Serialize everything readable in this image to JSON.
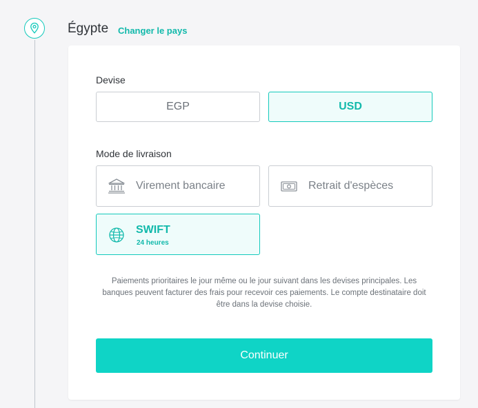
{
  "country": {
    "name": "Égypte",
    "change_link": "Changer le pays",
    "icon": "location-pin-icon"
  },
  "currency": {
    "label": "Devise",
    "options": [
      {
        "label": "EGP",
        "selected": false
      },
      {
        "label": "USD",
        "selected": true
      }
    ]
  },
  "delivery": {
    "label": "Mode de livraison",
    "options": [
      {
        "label": "Virement bancaire",
        "icon": "bank-icon",
        "selected": false
      },
      {
        "label": "Retrait d'espèces",
        "icon": "cash-icon",
        "selected": false
      },
      {
        "label": "SWIFT",
        "sublabel": "24 heures",
        "icon": "globe-icon",
        "selected": true
      }
    ]
  },
  "description": "Paiements prioritaires le jour même ou le jour suivant dans les devises principales. Les banques peuvent facturer des frais pour recevoir ces paiements. Le compte destinataire doit être dans la devise choisie.",
  "continue_label": "Continuer",
  "colors": {
    "accent": "#12c9bb",
    "button": "#0fd4c6",
    "selected_bg": "#effcfb"
  }
}
